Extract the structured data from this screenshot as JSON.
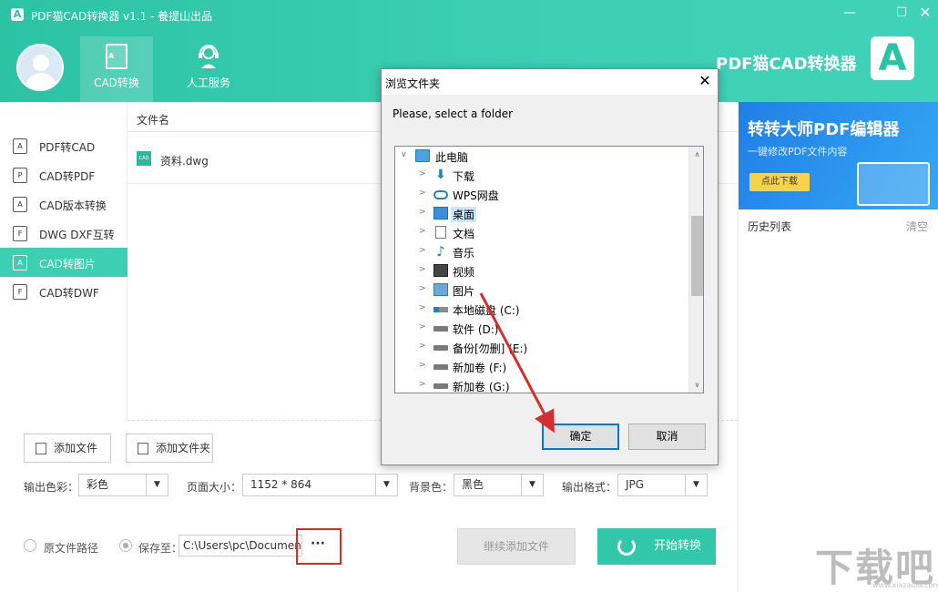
{
  "window": {
    "title": "PDF猫CAD转换器 v1.1 - 養提山出品",
    "brand": "PDF猫CAD转换器",
    "brand_logo": "A",
    "small_logo": "A",
    "minimize": "—",
    "maximize": "☐",
    "close": "✕"
  },
  "nav": {
    "tabs": [
      {
        "label": "CAD转换",
        "icon": "cad-doc-icon",
        "active": true,
        "icon_text": "A"
      },
      {
        "label": "人工服务",
        "icon": "headset-icon",
        "active": false
      }
    ]
  },
  "sidebar": {
    "items": [
      {
        "label": "PDF转CAD",
        "icon": "A",
        "active": false
      },
      {
        "label": "CAD转PDF",
        "icon": "P",
        "active": false
      },
      {
        "label": "CAD版本转换",
        "icon": "A",
        "active": false
      },
      {
        "label": "DWG DXF互转",
        "icon": "F",
        "active": false
      },
      {
        "label": "CAD转图片",
        "icon": "A",
        "active": true
      },
      {
        "label": "CAD转DWF",
        "icon": "F",
        "active": false
      }
    ]
  },
  "file_list": {
    "header": "文件名",
    "files": [
      {
        "name": "资料.dwg",
        "thumb": "CAD"
      }
    ]
  },
  "ad": {
    "title": "转转大师PDF编辑器",
    "subtitle": "一键修改PDF文件内容",
    "button": "点此下载"
  },
  "history": {
    "label": "历史列表",
    "clear": "清空"
  },
  "actions": {
    "add_file": "添加文件",
    "add_folder": "添加文件夹"
  },
  "options": {
    "color_label": "输出色彩：",
    "color_value": "彩色",
    "size_label": "页面大小：",
    "size_value": "1152 * 864",
    "bg_label": "背景色：",
    "bg_value": "黑色",
    "format_label": "输出格式：",
    "format_value": "JPG",
    "arrow": "▼"
  },
  "output": {
    "original_path_label": "原文件路径",
    "save_to_label": "保存至：",
    "path_value": "C:\\Users\\pc\\Documents",
    "browse": "···",
    "continue_label": "继续添加文件",
    "start_label": "开始转换"
  },
  "dialog": {
    "title": "浏览文件夹",
    "close": "✕",
    "description": "Please, select a folder",
    "tree": [
      {
        "label": "此电脑",
        "level": 0,
        "expander": "∨",
        "icon": "pc-icon"
      },
      {
        "label": "下载",
        "level": 1,
        "expander": ">",
        "icon": "download-icon",
        "glyph": "⬇"
      },
      {
        "label": "WPS网盘",
        "level": 1,
        "expander": ">",
        "icon": "cloud-icon"
      },
      {
        "label": "桌面",
        "level": 1,
        "expander": ">",
        "icon": "desktop-icon",
        "selected": true
      },
      {
        "label": "文档",
        "level": 1,
        "expander": ">",
        "icon": "documents-icon"
      },
      {
        "label": "音乐",
        "level": 1,
        "expander": ">",
        "icon": "music-icon",
        "glyph": "♪"
      },
      {
        "label": "视频",
        "level": 1,
        "expander": ">",
        "icon": "video-icon"
      },
      {
        "label": "图片",
        "level": 1,
        "expander": ">",
        "icon": "pictures-icon"
      },
      {
        "label": "本地磁盘 (C:)",
        "level": 1,
        "expander": ">",
        "icon": "system-drive-icon"
      },
      {
        "label": "软件 (D:)",
        "level": 1,
        "expander": ">",
        "icon": "drive-icon"
      },
      {
        "label": "备份[勿删] (E:)",
        "level": 1,
        "expander": ">",
        "icon": "drive-icon"
      },
      {
        "label": "新加卷 (F:)",
        "level": 1,
        "expander": ">",
        "icon": "drive-icon"
      },
      {
        "label": "新加卷 (G:)",
        "level": 1,
        "expander": ">",
        "icon": "drive-icon"
      }
    ],
    "scroll_up": "∧",
    "scroll_down": "∨",
    "ok": "确定",
    "cancel": "取消"
  },
  "watermark": {
    "text": "下载吧",
    "url": "www.xiazaiba.com"
  },
  "colors": {
    "accent": "#33c7aa",
    "annotation": "#d32f2f"
  }
}
